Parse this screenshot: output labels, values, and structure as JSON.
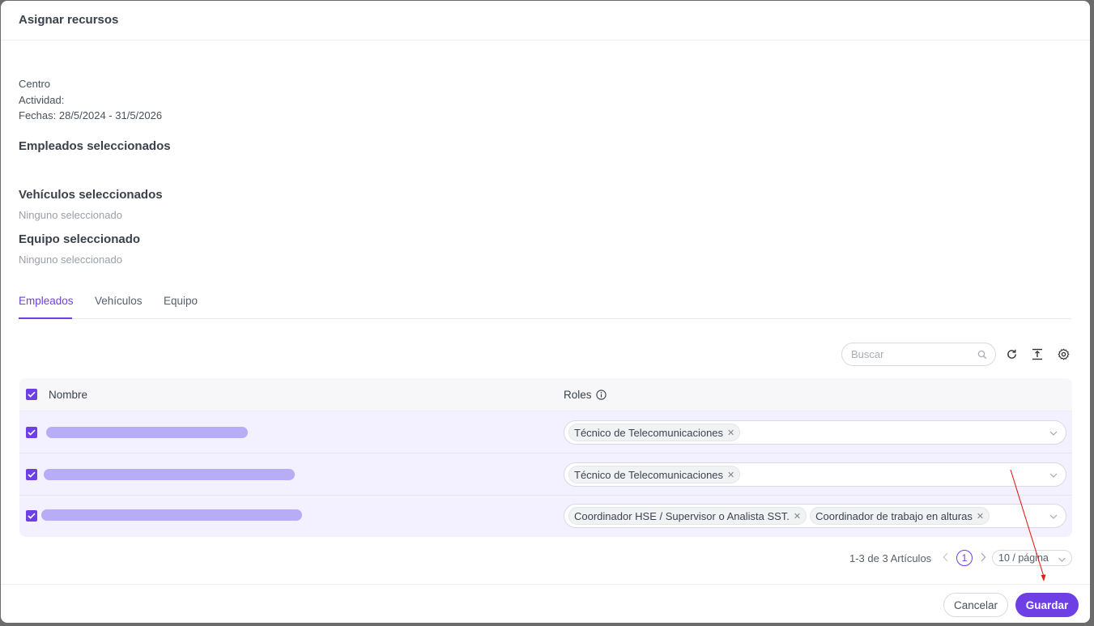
{
  "modal": {
    "title": "Asignar recursos"
  },
  "info": {
    "centro": "Centro",
    "actividad": "Actividad:",
    "fechas": "Fechas: 28/5/2024 - 31/5/2026"
  },
  "sections": {
    "empleados_title": "Empleados seleccionados",
    "vehiculos_title": "Vehículos seleccionados",
    "vehiculos_empty": "Ninguno seleccionado",
    "equipo_title": "Equipo seleccionado",
    "equipo_empty": "Ninguno seleccionado"
  },
  "tabs": [
    {
      "label": "Empleados",
      "active": true
    },
    {
      "label": "Vehículos",
      "active": false
    },
    {
      "label": "Equipo",
      "active": false
    }
  ],
  "toolbar": {
    "search_placeholder": "Buscar",
    "icons": [
      "search-icon",
      "reload-icon",
      "column-height-icon",
      "settings-icon"
    ]
  },
  "table": {
    "columns": {
      "name": "Nombre",
      "roles": "Roles"
    },
    "rows": [
      {
        "checked": true,
        "roles": [
          "Técnico de Telecomunicaciones"
        ]
      },
      {
        "checked": true,
        "roles": [
          "Técnico de Telecomunicaciones"
        ]
      },
      {
        "checked": true,
        "roles": [
          "Coordinador HSE / Supervisor o Analista SST.",
          "Coordinador de trabajo en alturas"
        ]
      }
    ]
  },
  "pagination": {
    "total_text": "1-3 de 3 Artículos",
    "current_page": "1",
    "page_size": "10 / página"
  },
  "footer": {
    "cancel_label": "Cancelar",
    "save_label": "Guardar"
  },
  "colors": {
    "primary": "#6f3fe6",
    "row_selected": "#f3f0ff",
    "annotation_arrow": "#e0201a"
  }
}
